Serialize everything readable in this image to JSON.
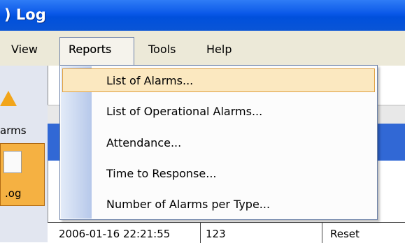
{
  "window": {
    "title": ") Log"
  },
  "menu": {
    "view": "View",
    "reports": "Reports",
    "tools": "Tools",
    "help": "Help"
  },
  "sidebar": {
    "alarms_label": "arms",
    "log_label": ".og"
  },
  "reports_menu": {
    "items": [
      {
        "label": "List of Alarms..."
      },
      {
        "label": "List of Operational Alarms..."
      },
      {
        "label": "Attendance..."
      },
      {
        "label": "Time to Response..."
      },
      {
        "label": "Number of Alarms per Type..."
      }
    ]
  },
  "table": {
    "row": {
      "timestamp": "2006-01-16 22:21:55",
      "id": "123",
      "action": "Reset"
    }
  },
  "colors": {
    "titlebar": "#0a58e8",
    "menubar": "#ece9d8",
    "highlight": "#fbe8c0",
    "selection": "#3168d5"
  }
}
